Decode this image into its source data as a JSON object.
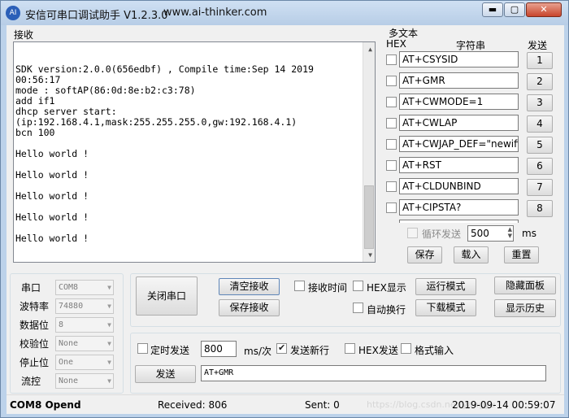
{
  "window": {
    "title": "安信可串口调试助手 V1.2.3.0",
    "url": "www.ai-thinker.com",
    "icon_text": "AI",
    "minimize": "▬",
    "maximize": "▢",
    "close": "✕"
  },
  "receive": {
    "label": "接收",
    "text": "SDK version:2.0.0(656edbf) , Compile time:Sep 14 2019\n00:56:17\nmode : softAP(86:0d:8e:b2:c3:78)\nadd if1\ndhcp server start:\n(ip:192.168.4.1,mask:255.255.255.0,gw:192.168.4.1)\nbcn 100\n\nHello world !\n\nHello world !\n\nHello world !\n\nHello world !\n\nHello world !"
  },
  "multitext": {
    "label": "多文本",
    "header_hex": "HEX",
    "header_str": "字符串",
    "header_send": "发送",
    "rows": [
      {
        "cmd": "AT+CSYSID",
        "num": "1"
      },
      {
        "cmd": "AT+GMR",
        "num": "2"
      },
      {
        "cmd": "AT+CWMODE=1",
        "num": "3"
      },
      {
        "cmd": "AT+CWLAP",
        "num": "4"
      },
      {
        "cmd": "AT+CWJAP_DEF=\"newifi_",
        "num": "5"
      },
      {
        "cmd": "AT+RST",
        "num": "6"
      },
      {
        "cmd": "AT+CLDUNBIND",
        "num": "7"
      },
      {
        "cmd": "AT+CIPSTA?",
        "num": "8"
      }
    ],
    "loop_send": "循环发送",
    "interval": "500",
    "ms": "ms",
    "save": "保存",
    "load": "载入",
    "reset": "重置"
  },
  "port_settings": {
    "port_label": "串口",
    "port_value": "COM8",
    "baud_label": "波特率",
    "baud_value": "74880",
    "data_label": "数据位",
    "data_value": "8",
    "parity_label": "校验位",
    "parity_value": "None",
    "stop_label": "停止位",
    "stop_value": "One",
    "flow_label": "流控",
    "flow_value": "None"
  },
  "controls": {
    "close_port": "关闭串口",
    "clear_recv": "清空接收",
    "save_recv": "保存接收",
    "recv_time": "接收时间",
    "hex_display": "HEX显示",
    "auto_wrap": "自动换行",
    "run_mode": "运行模式",
    "download_mode": "下载模式",
    "hide_panel": "隐藏面板",
    "show_history": "显示历史"
  },
  "send": {
    "timed_send": "定时发送",
    "period": "800",
    "period_unit": "ms/次",
    "send_newline": "发送新行",
    "hex_send": "HEX发送",
    "format_input": "格式输入",
    "send_button": "发送",
    "send_text": "AT+GMR"
  },
  "status": {
    "port": "COM8 Opend",
    "received": "Received: 806",
    "sent": "Sent: 0",
    "datetime": "2019-09-14 00:59:07",
    "watermark": "https://blog.csdn.net/yangyu"
  }
}
